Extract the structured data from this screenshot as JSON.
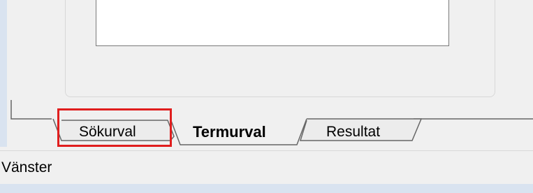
{
  "tabs": [
    {
      "label": "Sökurval",
      "active": false,
      "highlighted": true
    },
    {
      "label": "Termurval",
      "active": true,
      "highlighted": false
    },
    {
      "label": "Resultat",
      "active": false,
      "highlighted": false
    }
  ],
  "status_bar": {
    "text": "Vänster"
  },
  "colors": {
    "highlight_border": "#e01e1e",
    "window_background": "#f0f0f0",
    "frame_strip": "#d9e3f0"
  }
}
